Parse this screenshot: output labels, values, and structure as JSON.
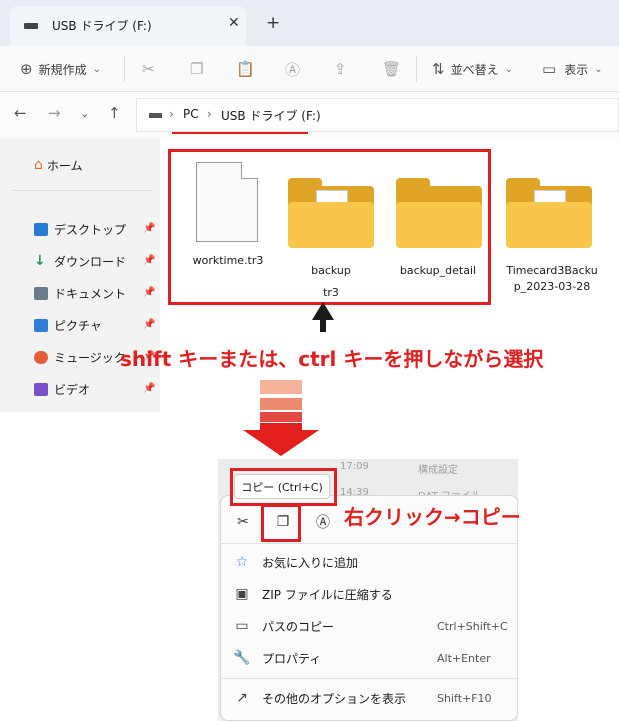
{
  "window": {
    "tab_title": "USB ドライブ (F:)",
    "tab_close": "✕",
    "new_tab": "+"
  },
  "toolbar": {
    "new_label": "新規作成",
    "sort_label": "並べ替え",
    "view_label": "表示",
    "chevron": "⌄"
  },
  "address": {
    "crumbs": [
      "PC",
      "USB ドライブ (F:)"
    ],
    "separator": "›"
  },
  "sidebar": {
    "home": "ホーム",
    "items": [
      {
        "label": "デスクトップ",
        "color": "#2a7bd6"
      },
      {
        "label": "ダウンロード",
        "color": "#1f9e5a"
      },
      {
        "label": "ドキュメント",
        "color": "#6b7b8c"
      },
      {
        "label": "ピクチャ",
        "color": "#2f7fd8"
      },
      {
        "label": "ミュージック",
        "color": "#e0603a"
      },
      {
        "label": "ビデオ",
        "color": "#7b4fc8"
      }
    ]
  },
  "files": [
    {
      "name": "worktime.tr3",
      "type": "file"
    },
    {
      "name": "backup",
      "name2": "tr3",
      "type": "folder"
    },
    {
      "name": "backup_detail",
      "type": "folder"
    },
    {
      "name": "Timecard3Backu",
      "name2": "p_2023-03-28",
      "type": "folder"
    }
  ],
  "annotations": {
    "select_hint": "shift キーまたは、ctrl キーを押しながら選択",
    "copy_hint": "右クリック→コピー",
    "accent_color": "#e02020"
  },
  "context_menu": {
    "background_rows": [
      {
        "time": "17:09",
        "type": "構成設定"
      },
      {
        "time": "14:39",
        "type": "DAT ファイル"
      }
    ],
    "tooltip": "コピー (Ctrl+C)",
    "items": [
      {
        "label": "お気に入りに追加",
        "shortcut": "",
        "icon": "☆"
      },
      {
        "label": "ZIP ファイルに圧縮する",
        "shortcut": "",
        "icon": "▣"
      },
      {
        "label": "パスのコピー",
        "shortcut": "Ctrl+Shift+C",
        "icon": "▭"
      },
      {
        "label": "プロパティ",
        "shortcut": "Alt+Enter",
        "icon": "🔧"
      },
      {
        "label": "その他のオプションを表示",
        "shortcut": "Shift+F10",
        "icon": "↗"
      }
    ]
  }
}
